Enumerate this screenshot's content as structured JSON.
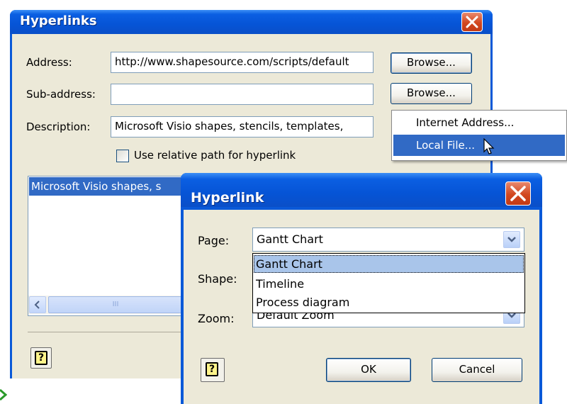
{
  "hyperlinks_dialog": {
    "title": "Hyperlinks",
    "address_label": "Address:",
    "address_value": "http://www.shapesource.com/scripts/default",
    "subaddress_label": "Sub-address:",
    "subaddress_value": "",
    "description_label": "Description:",
    "description_value": "Microsoft Visio shapes, stencils, templates,",
    "browse_label_1": "Browse...",
    "browse_label_2": "Browse...",
    "relative_path_label": "Use relative path for hyperlink",
    "relative_path_checked": false,
    "list_item": "Microsoft Visio shapes, s",
    "scroll_mark": "III"
  },
  "browse_menu": {
    "items": [
      {
        "label": "Internet Address..."
      },
      {
        "label": "Local File..."
      }
    ],
    "selected_index": 1
  },
  "hyperlink_dialog": {
    "title": "Hyperlink",
    "page_label": "Page:",
    "page_value": "Gantt Chart",
    "page_options": [
      "Gantt Chart",
      "Timeline",
      "Process diagram"
    ],
    "selected_option": "Gantt Chart",
    "shape_label": "Shape:",
    "zoom_label": "Zoom:",
    "zoom_value": "Default Zoom",
    "ok_label": "OK",
    "cancel_label": "Cancel"
  },
  "icons": [
    "close-icon",
    "help-icon",
    "chevron-down-icon",
    "mouse-cursor-icon",
    "scroll-left-icon"
  ],
  "colors": {
    "titlebar_blue": "#0654d6",
    "dialog_face": "#ece9d8",
    "menu_highlight": "#316ac5",
    "list_selection": "#316ac5",
    "close_red": "#d2471f"
  }
}
